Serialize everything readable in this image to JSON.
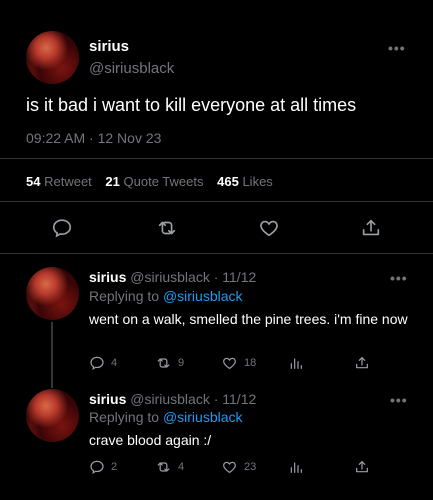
{
  "main_tweet": {
    "name": "sirius",
    "handle": "@siriusblack",
    "text": "is it bad i want to kill everyone at all times",
    "time": "09:22 AM · 12 Nov 23",
    "more_icon": "more-dots-icon",
    "stats": {
      "retweets": "54",
      "retweets_label": "Retweet",
      "quotes": "21",
      "quotes_label": "Quote Tweets",
      "likes": "465",
      "likes_label": "Likes"
    },
    "actions": [
      "reply-icon",
      "retweet-icon",
      "like-icon",
      "share-icon"
    ]
  },
  "replies": [
    {
      "name": "sirius",
      "handle": "@siriusblack",
      "date": "· 11/12",
      "replying_prefix": "Replying to",
      "replying_to": "@siriusblack",
      "text": "went on a walk, smelled the pine trees. i'm fine now",
      "reply_count": "4",
      "retweet_count": "9",
      "like_count": "18"
    },
    {
      "name": "sirius",
      "handle": "@siriusblack",
      "date": "· 11/12",
      "replying_prefix": "Replying to",
      "replying_to": "@siriusblack",
      "text": "crave blood again :/",
      "reply_count": "2",
      "retweet_count": "4",
      "like_count": "23"
    }
  ],
  "colors": {
    "background": "#000000",
    "text": "#e7e9ea",
    "muted": "#71767b",
    "link": "#1d9bf0",
    "divider": "#2f3336"
  }
}
